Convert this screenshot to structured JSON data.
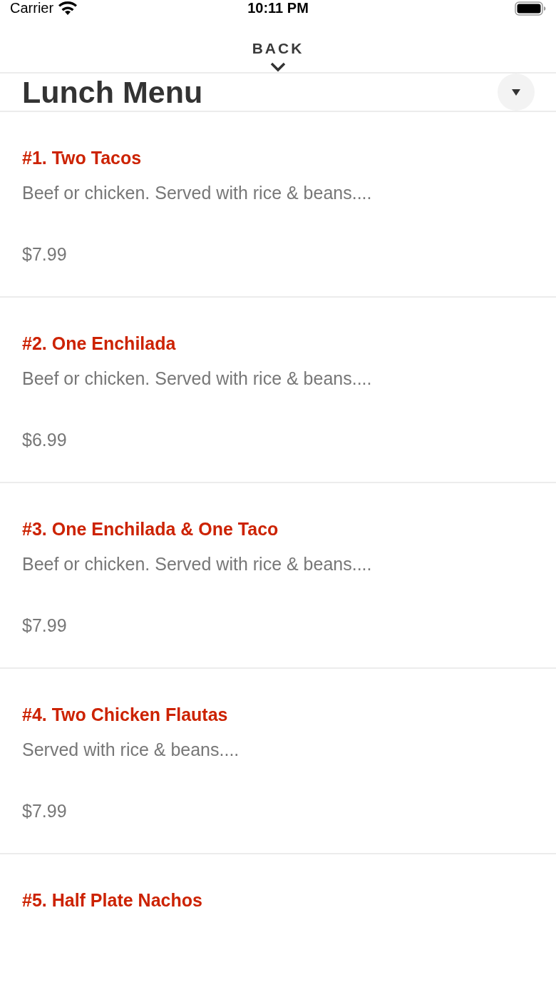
{
  "status_bar": {
    "carrier": "Carrier",
    "time": "10:11 PM"
  },
  "header": {
    "back_label": "BACK"
  },
  "section": {
    "title": "Lunch Menu"
  },
  "items": [
    {
      "name": "#1. Two Tacos",
      "description": "Beef or chicken. Served with rice & beans....",
      "price": "$7.99"
    },
    {
      "name": "#2. One Enchilada",
      "description": "Beef or chicken. Served with rice & beans....",
      "price": "$6.99"
    },
    {
      "name": "#3. One Enchilada & One Taco",
      "description": "Beef or chicken. Served with rice & beans....",
      "price": "$7.99"
    },
    {
      "name": "#4. Two Chicken Flautas",
      "description": "Served with rice & beans....",
      "price": "$7.99"
    },
    {
      "name": "#5. Half Plate Nachos"
    }
  ]
}
